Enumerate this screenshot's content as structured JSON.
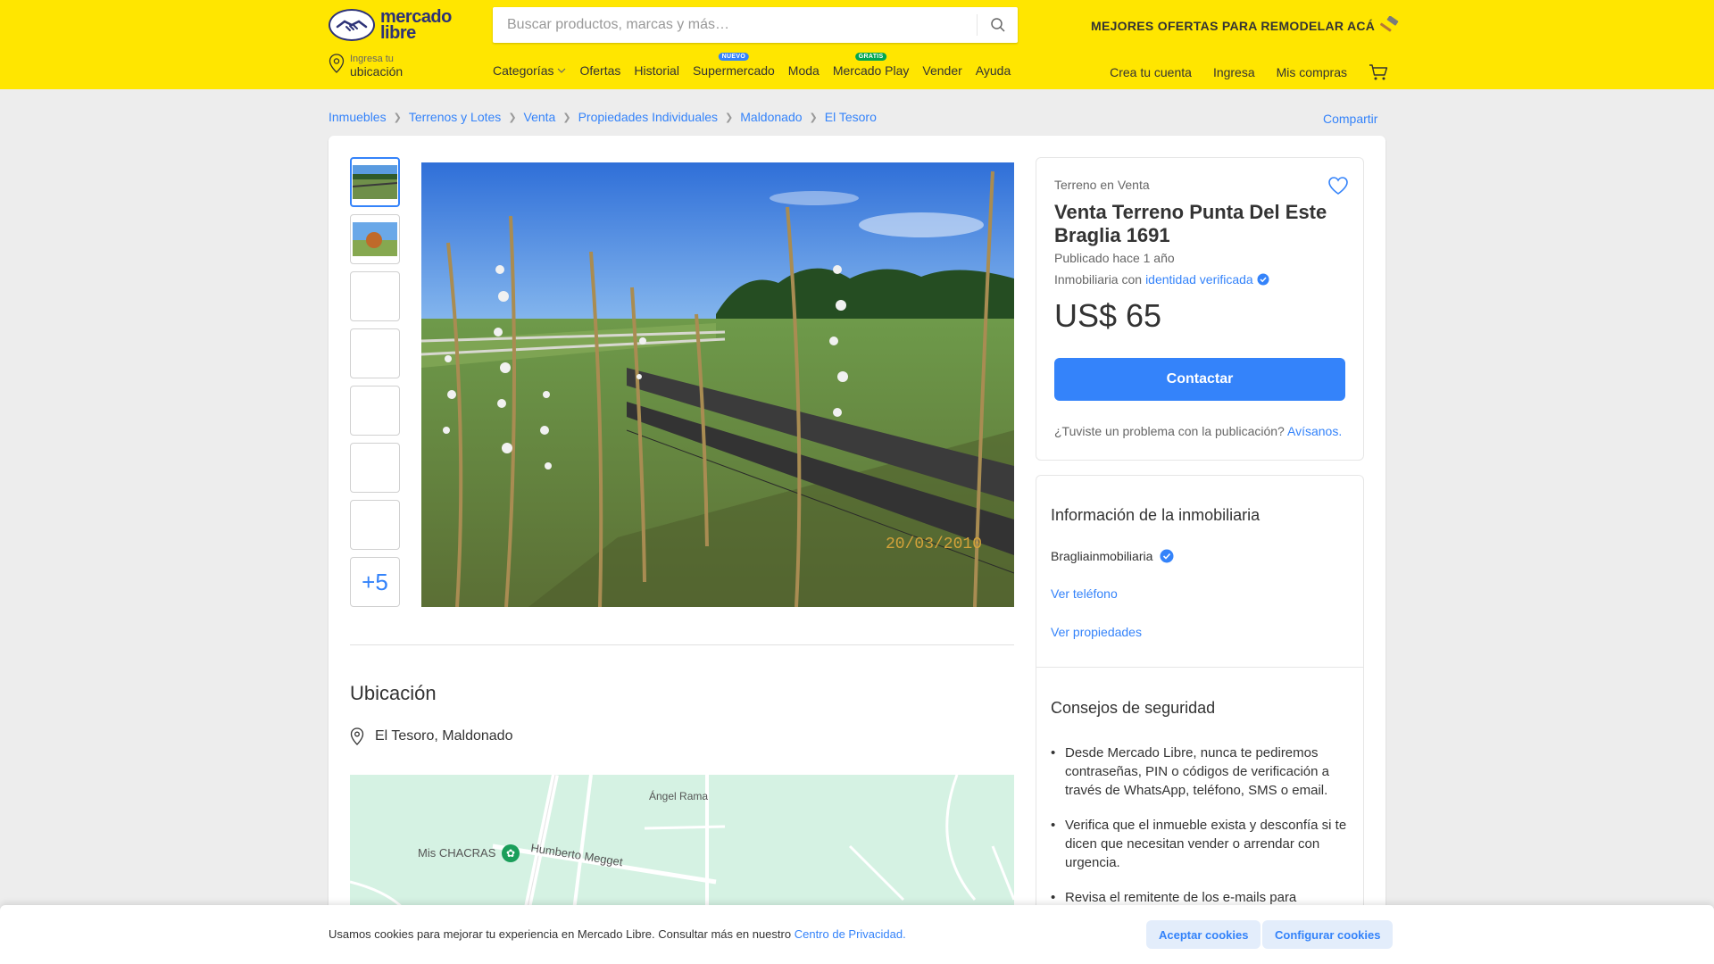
{
  "header": {
    "logo_text": "mercado libre",
    "search_placeholder": "Buscar productos, marcas y más…",
    "promo": "MEJORES OFERTAS PARA REMODELAR ACÁ",
    "location_line1": "Ingresa tu",
    "location_line2": "ubicación",
    "nav": [
      {
        "label": "Categorías"
      },
      {
        "label": "Ofertas"
      },
      {
        "label": "Historial"
      },
      {
        "label": "Supermercado",
        "badge": "NUEVO"
      },
      {
        "label": "Moda"
      },
      {
        "label": "Mercado Play",
        "badge": "GRATIS"
      },
      {
        "label": "Vender"
      },
      {
        "label": "Ayuda"
      }
    ],
    "user_nav": [
      "Crea tu cuenta",
      "Ingresa",
      "Mis compras"
    ]
  },
  "breadcrumb": [
    "Inmuebles",
    "Terrenos y Lotes",
    "Venta",
    "Propiedades Individuales",
    "Maldonado",
    "El Tesoro"
  ],
  "share_label": "Compartir",
  "gallery": {
    "more_label": "+5",
    "photo_date": "20/03/2010"
  },
  "location": {
    "title": "Ubicación",
    "address": "El Tesoro, Maldonado",
    "map_labels": [
      "Ángel Rama",
      "Mis CHACRAS",
      "Humberto Megget"
    ]
  },
  "listing": {
    "subtitle": "Terreno en Venta",
    "title": "Venta Terreno Punta Del Este Braglia 1691",
    "posted": "Publicado hace 1 año",
    "verified_prefix": "Inmobiliaria con",
    "verified_link": "identidad verificada",
    "price": "US$ 65",
    "contact_label": "Contactar",
    "report_text": "¿Tuviste un problema con la publicación?",
    "report_link": "Avísanos."
  },
  "agency": {
    "title": "Información de la inmobiliaria",
    "name": "Bragliainmobiliaria",
    "phone_link": "Ver teléfono",
    "properties_link": "Ver propiedades"
  },
  "safety": {
    "title": "Consejos de seguridad",
    "tips": [
      "Desde Mercado Libre, nunca te pediremos contraseñas, PIN o códigos de verificación a través de WhatsApp, teléfono, SMS o email.",
      "Verifica que el inmueble exista y desconfía si te dicen que necesitan vender o arrendar con urgencia.",
      "Revisa el remitente de los e-mails para"
    ]
  },
  "cookie": {
    "text": "Usamos cookies para mejorar tu experiencia en Mercado Libre. Consultar más en nuestro",
    "link": "Centro de Privacidad.",
    "accept": "Aceptar cookies",
    "configure": "Configurar cookies"
  },
  "colors": {
    "header_bg": "#ffe600",
    "accent": "#3483fa",
    "map_bg": "#d5f2e3"
  }
}
